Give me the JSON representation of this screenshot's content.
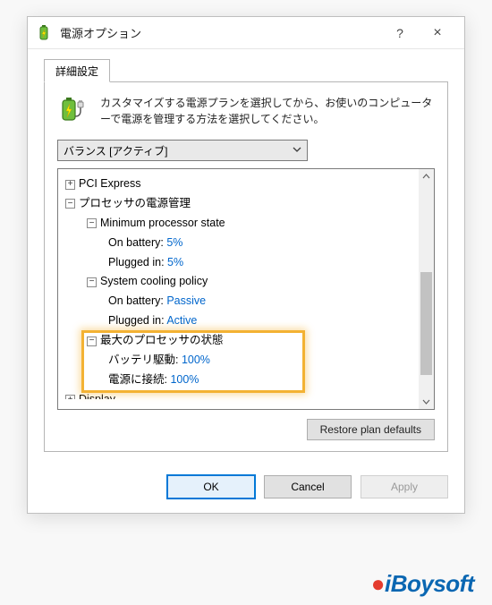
{
  "window": {
    "title": "電源オプション",
    "help_symbol": "?",
    "close_symbol": "×"
  },
  "tab": {
    "label": "詳細設定"
  },
  "intro": {
    "text": "カスタマイズする電源プランを選択してから、お使いのコンピューターで電源を管理する方法を選択してください。"
  },
  "plan_combo": {
    "value": "バランス [アクティブ]"
  },
  "tree": {
    "items": [
      {
        "level": 1,
        "expander": "+",
        "label": "PCI Express"
      },
      {
        "level": 1,
        "expander": "-",
        "label": "プロセッサの電源管理"
      },
      {
        "level": 2,
        "expander": "-",
        "label": "Minimum processor state"
      },
      {
        "level": 3,
        "label_prefix": "On battery: ",
        "value": "5%"
      },
      {
        "level": 3,
        "label_prefix": "Plugged in: ",
        "value": "5%"
      },
      {
        "level": 2,
        "expander": "-",
        "label": "System cooling policy"
      },
      {
        "level": 3,
        "label_prefix": "On battery: ",
        "value": "Passive"
      },
      {
        "level": 3,
        "label_prefix": "Plugged in: ",
        "value": "Active"
      },
      {
        "level": 2,
        "expander": "-",
        "label": "最大のプロセッサの状態",
        "highlight": true
      },
      {
        "level": 3,
        "label_prefix": "バッテリ駆動: ",
        "value": "100%",
        "highlight": true
      },
      {
        "level": 3,
        "label_prefix": "電源に接続: ",
        "value": "100%",
        "highlight": true
      },
      {
        "level": 1,
        "expander": "+",
        "label": "Display",
        "cut": true
      }
    ]
  },
  "buttons": {
    "restore": "Restore plan defaults",
    "ok": "OK",
    "cancel": "Cancel",
    "apply": "Apply"
  },
  "watermark": {
    "text_i": "i",
    "text_rest": "Boysoft"
  }
}
